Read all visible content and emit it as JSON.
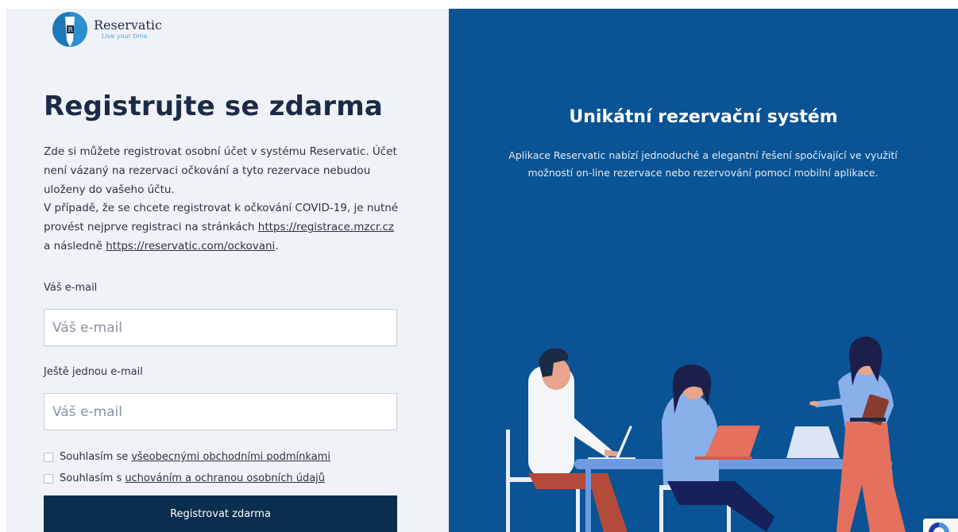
{
  "logo": {
    "name": "Reservatic",
    "tagline": "Live your time",
    "mark_letter": "R"
  },
  "register": {
    "title": "Registrujte se zdarma",
    "intro_p1": "Zde si můžete registrovat osobní účet v systému Reservatic. Účet není vázaný na rezervaci očkování a tyto rezervace nebudou uloženy do vašeho účtu.",
    "intro_p2_before": "V případě, že se chcete registrovat k očkování COVID-19, je nutné provést nejprve registraci na stránkách",
    "intro_link_1": "https://registrace.mzcr.cz",
    "intro_p2_middle": "a následně",
    "intro_link_2": "https://reservatic.com/ockovani",
    "intro_p2_end": "."
  },
  "form": {
    "email_label": "Váš e-mail",
    "email_placeholder": "Váš e-mail",
    "email_repeat_label": "Ještě jednou e-mail",
    "email_repeat_placeholder": "Váš e-mail",
    "consent_1_text": "Souhlasím se",
    "consent_1_link": "všeobecnými obchodními podmínkami",
    "consent_2_text": "Souhlasím s",
    "consent_2_link": "uchováním a ochranou osobních údajů",
    "submit_label": "Registrovat zdarma"
  },
  "promo": {
    "title": "Unikátní rezervační systém",
    "text": "Aplikace Reservatic nabízí jednoduché a elegantní řešení spočívající ve využití možností on-line rezervace nebo rezervování pomocí mobilní aplikace."
  },
  "colors": {
    "promo_background": "#0a5394",
    "left_background": "#eff2f7",
    "button_background": "#0b2e4f",
    "title_color": "#1c2b45",
    "accent": "#1b77b8"
  }
}
